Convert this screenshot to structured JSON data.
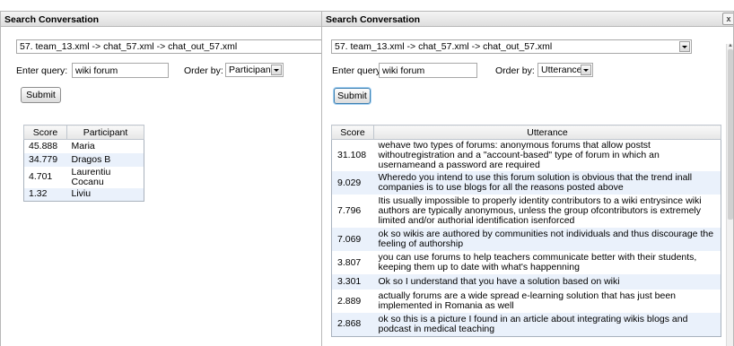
{
  "left_window": {
    "title": "Search Conversation",
    "conversation_select": "57. team_13.xml -> chat_57.xml -> chat_out_57.xml",
    "query_label": "Enter query:",
    "query_value": "wiki forum",
    "order_label": "Order by:",
    "order_value": "Participants",
    "submit_label": "Submit",
    "table": {
      "headers": [
        "Score",
        "Participant"
      ],
      "rows": [
        {
          "score": "45.888",
          "participant": "Maria"
        },
        {
          "score": "34.779",
          "participant": "Dragos B"
        },
        {
          "score": "4.701",
          "participant": "Laurentiu Cocanu"
        },
        {
          "score": "1.32",
          "participant": "Liviu"
        }
      ]
    }
  },
  "right_window": {
    "title": "Search Conversation",
    "close_label": "x",
    "conversation_select": "57. team_13.xml -> chat_57.xml -> chat_out_57.xml",
    "query_label": "Enter query:",
    "query_value": "wiki forum",
    "order_label": "Order by:",
    "order_value": "Utterances",
    "submit_label": "Submit",
    "table": {
      "headers": [
        "Score",
        "Utterance"
      ],
      "rows": [
        {
          "score": "31.108",
          "utterance": "wehave two types of forums: anonymous forums that allow postst withoutregistration and a \"account-based\" type of forum in which an usernameand a password are required"
        },
        {
          "score": "9.029",
          "utterance": "Wheredo you intend to use this forum solution is obvious that the trend inall companies is to use blogs for all the reasons posted above"
        },
        {
          "score": "7.796",
          "utterance": "Itis usually impossible to properly identity contributors to a wiki entrysince wiki authors are typically anonymous, unless the group ofcontributors is extremely limited and/or authorial identification isenforced"
        },
        {
          "score": "7.069",
          "utterance": "ok so wikis are authored by communities not individuals and thus discourage the feeling of authorship"
        },
        {
          "score": "3.807",
          "utterance": "you can use forums to help teachers communicate better with their students, keeping them up to date with what's happenning"
        },
        {
          "score": "3.301",
          "utterance": "Ok so I understand that you have a solution based on wiki"
        },
        {
          "score": "2.889",
          "utterance": "actually forums are a wide spread e-learning solution that has just been implemented in Romania as well"
        },
        {
          "score": "2.868",
          "utterance": "ok so this is a picture I found in an article about integrating wikis blogs and podcast in medical teaching"
        }
      ]
    }
  }
}
